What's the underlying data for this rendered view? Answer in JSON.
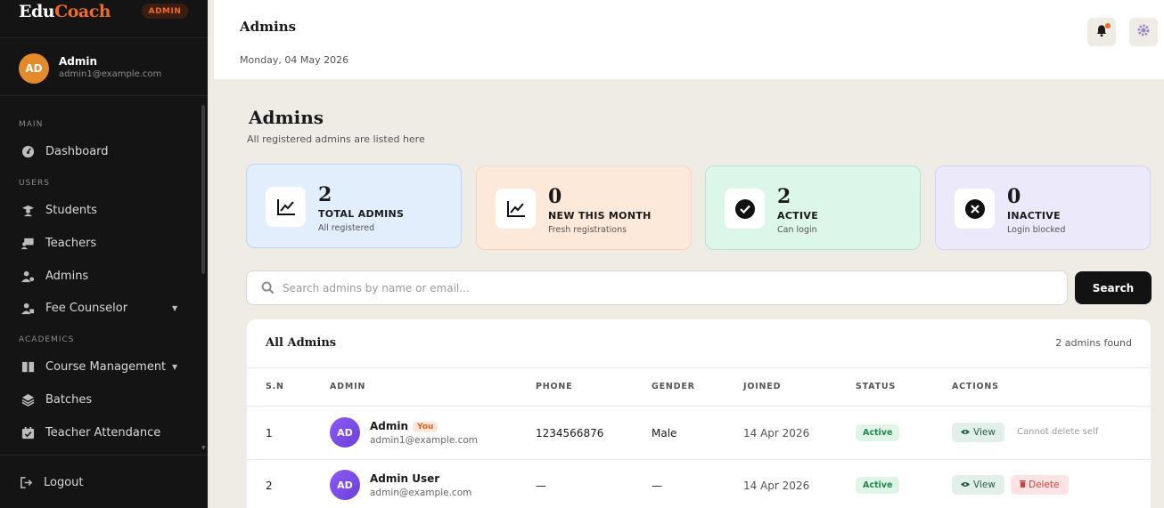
{
  "brand": {
    "part1": "Edu",
    "part2": "Coach",
    "role_pill": "ADMIN"
  },
  "user": {
    "initials": "AD",
    "name": "Admin",
    "email": "admin1@example.com"
  },
  "sidebar": {
    "sections": [
      "MAIN",
      "USERS",
      "ACADEMICS"
    ],
    "items": [
      {
        "label": "Dashboard",
        "icon": "dashboard-icon"
      },
      {
        "label": "Students",
        "icon": "student-icon"
      },
      {
        "label": "Teachers",
        "icon": "teacher-icon"
      },
      {
        "label": "Admins",
        "icon": "admin-icon"
      },
      {
        "label": "Fee Counselor",
        "icon": "fee-counselor-icon"
      },
      {
        "label": "Course Management",
        "icon": "book-icon"
      },
      {
        "label": "Batches",
        "icon": "layers-icon"
      },
      {
        "label": "Teacher Attendance",
        "icon": "calendar-check-icon"
      }
    ],
    "logout": "Logout"
  },
  "header": {
    "title": "Admins",
    "date": "Monday, 04 May 2026"
  },
  "page": {
    "title": "Admins",
    "subtitle": "All registered admins are listed here"
  },
  "stats": [
    {
      "value": "2",
      "label": "TOTAL ADMINS",
      "sub": "All registered",
      "icon": "trend-icon",
      "bg": "#e3eefc"
    },
    {
      "value": "0",
      "label": "NEW THIS MONTH",
      "sub": "Fresh registrations",
      "icon": "trend-icon",
      "bg": "#fde9da"
    },
    {
      "value": "2",
      "label": "ACTIVE",
      "sub": "Can login",
      "icon": "check-circle-icon",
      "bg": "#dcf6ea"
    },
    {
      "value": "0",
      "label": "INACTIVE",
      "sub": "Login blocked",
      "icon": "x-circle-icon",
      "bg": "#ece9fb"
    }
  ],
  "search": {
    "placeholder": "Search admins by name or email...",
    "button": "Search"
  },
  "table": {
    "title": "All Admins",
    "count": "2 admins found",
    "columns": [
      "S.N",
      "ADMIN",
      "PHONE",
      "GENDER",
      "JOINED",
      "STATUS",
      "ACTIONS"
    ],
    "rows": [
      {
        "sn": "1",
        "initials": "AD",
        "name": "Admin",
        "badge": "You",
        "email": "admin1@example.com",
        "phone": "1234566876",
        "gender": "Male",
        "joined": "14 Apr 2026",
        "status": "Active",
        "view": "View",
        "note": "Cannot delete self"
      },
      {
        "sn": "2",
        "initials": "AD",
        "name": "Admin User",
        "email": "admin@example.com",
        "phone": "—",
        "gender": "—",
        "joined": "14 Apr 2026",
        "status": "Active",
        "view": "View",
        "delete": "Delete"
      }
    ]
  },
  "colors": {
    "accent": "#f06a1f",
    "sidebar_bg": "#141414",
    "page_bg": "#efece6",
    "status_active": "#1e8a4b"
  }
}
